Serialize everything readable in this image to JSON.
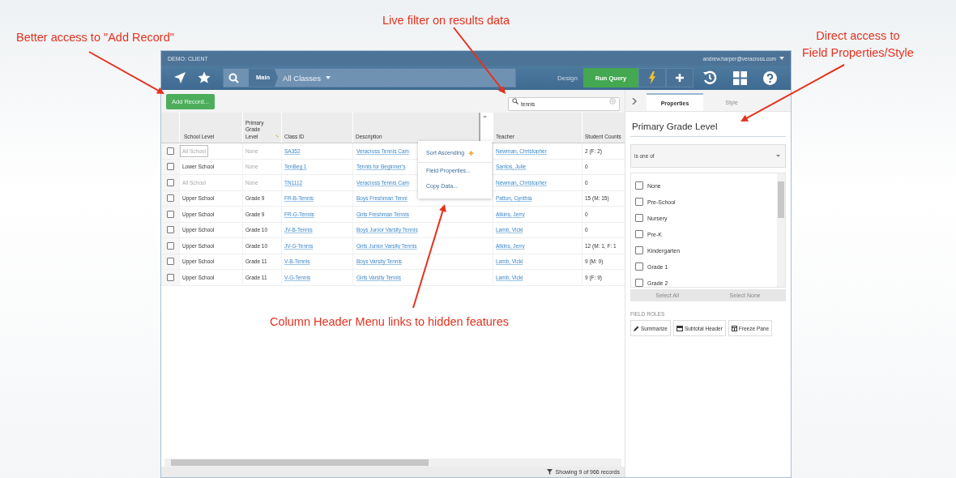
{
  "annotations": [
    {
      "text": "Better access to \"Add Record\""
    },
    {
      "text": "Live filter on results data"
    },
    {
      "text": "Direct access to\nField Properties/Style"
    },
    {
      "text": "Column Header Menu links to hidden features"
    }
  ],
  "app": {
    "title": "DEMO: CLIENT",
    "user": "andrew.harper@veracross.com",
    "breadcrumb_main": "Main",
    "breadcrumb_current": "All Classes",
    "design_label": "Design",
    "run_query": "Run Query"
  },
  "toolbar": {
    "add_button": "Add Record...",
    "search": {
      "value": "tennis"
    }
  },
  "grid": {
    "columns": [
      "School Level",
      "Primary Grade Level",
      "Class ID",
      "Description",
      "Teacher",
      "Student Counts"
    ],
    "rows": [
      {
        "school_level": "All School",
        "level_dimmed": true,
        "cell_focused": true,
        "grade": "None",
        "grade_dimmed": true,
        "class_id": "SA352",
        "description": "Veracross Tennis Cam",
        "teacher": "Newman, Christopher",
        "counts": "2 (F: 2)",
        "checked": false
      },
      {
        "school_level": "Lower School",
        "level_dimmed": false,
        "cell_focused": false,
        "grade": "None",
        "grade_dimmed": true,
        "class_id": "TenBeg 1",
        "description": "Tennis for Beginner's",
        "teacher": "Santos, Julie",
        "counts": "0",
        "checked": false
      },
      {
        "school_level": "All School",
        "level_dimmed": true,
        "cell_focused": false,
        "grade": "None",
        "grade_dimmed": true,
        "class_id": "TN1112",
        "description": "Veracross Tennis Cam",
        "teacher": "Newman, Christopher",
        "counts": "0",
        "checked": false
      },
      {
        "school_level": "Upper School",
        "level_dimmed": false,
        "cell_focused": false,
        "grade": "Grade 9",
        "grade_dimmed": false,
        "class_id": "FR-B-Tennis",
        "description": "Boys Freshman Tenni",
        "teacher": "Patton, Cynthia",
        "counts": "15 (M: 15)",
        "checked": false
      },
      {
        "school_level": "Upper School",
        "level_dimmed": false,
        "cell_focused": false,
        "grade": "Grade 9",
        "grade_dimmed": false,
        "class_id": "FR-G-Tennis",
        "description": "Girls Freshman Tennis",
        "teacher": "Atkins, Jerry",
        "counts": "0",
        "checked": false
      },
      {
        "school_level": "Upper School",
        "level_dimmed": false,
        "cell_focused": false,
        "grade": "Grade 10",
        "grade_dimmed": false,
        "class_id": "JV-B-Tennis",
        "description": "Boys Junior Varsity Tennis",
        "teacher": "Lamb, Vicki",
        "counts": "0",
        "checked": false
      },
      {
        "school_level": "Upper School",
        "level_dimmed": false,
        "cell_focused": false,
        "grade": "Grade 10",
        "grade_dimmed": false,
        "class_id": "JV-G-Tennis",
        "description": "Girls Junior Varsity Tennis",
        "teacher": "Atkins, Jerry",
        "counts": "12 (M: 1, F: 1",
        "checked": false
      },
      {
        "school_level": "Upper School",
        "level_dimmed": false,
        "cell_focused": false,
        "grade": "Grade 11",
        "grade_dimmed": false,
        "class_id": "V-B-Tennis",
        "description": "Boys Varsity Tennis",
        "teacher": "Lamb, Vicki",
        "counts": "9 (M: 9)",
        "checked": false
      },
      {
        "school_level": "Upper School",
        "level_dimmed": false,
        "cell_focused": false,
        "grade": "Grade 11",
        "grade_dimmed": false,
        "class_id": "V-G-Tennis",
        "description": "Girls Varsity Tennis",
        "teacher": "Lamb, Vicki",
        "counts": "9 (F: 9)",
        "checked": false
      }
    ]
  },
  "column_menu": {
    "items": [
      {
        "label": "Sort Ascending",
        "kind": "sort"
      },
      {
        "label": "Field Properties...",
        "kind": "plain"
      },
      {
        "label": "Copy Data...",
        "kind": "plain"
      }
    ]
  },
  "status": "Showing 9 of 966 records",
  "panel": {
    "tabs": [
      {
        "label": "Properties",
        "selected": true
      },
      {
        "label": "Style",
        "selected": false
      }
    ],
    "field_title": "Primary Grade Level",
    "operator": "is one of",
    "options": [
      {
        "label": "None",
        "checked": false
      },
      {
        "label": "Pre-School",
        "checked": false
      },
      {
        "label": "Nursery",
        "checked": false
      },
      {
        "label": "Pre-K",
        "checked": false
      },
      {
        "label": "Kindergarten",
        "checked": false
      },
      {
        "label": "Grade 1",
        "checked": false
      },
      {
        "label": "Grade 2",
        "checked": false
      }
    ],
    "select_all": "Select All",
    "select_none": "Select None",
    "roles_heading": "FIELD ROLES",
    "roles": [
      {
        "label": "Summarize",
        "kind": "pencil"
      },
      {
        "label": "Subtotal Header",
        "kind": "header"
      },
      {
        "label": "Freeze Pane",
        "kind": "freeze"
      }
    ]
  }
}
